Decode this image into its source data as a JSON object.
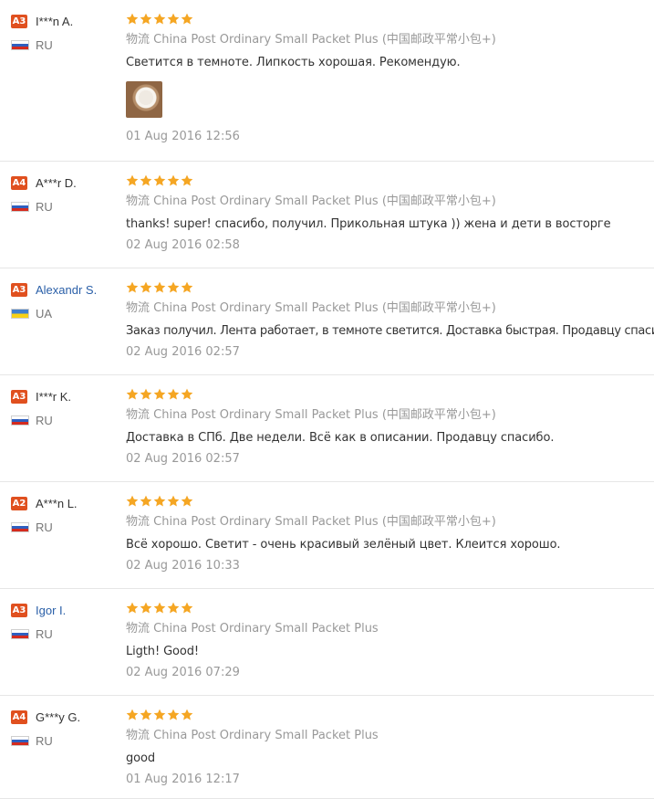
{
  "colors": {
    "badge": "#e0501f",
    "star": "#f5a623",
    "link": "#2a5fa8",
    "muted": "#999999"
  },
  "reviews": [
    {
      "level": "A3",
      "name": "I***n A.",
      "name_link": false,
      "flag": "ru-flag-icon",
      "country": "RU",
      "stars": 5,
      "ship_label": "物流",
      "shipping": "China Post Ordinary Small Packet Plus (中国邮政平常小包+)",
      "text": "Светится в темноте. Липкость хорошая. Рекомендую.",
      "has_photo": true,
      "date": "01 Aug 2016 12:56"
    },
    {
      "level": "A4",
      "name": "A***r D.",
      "name_link": false,
      "flag": "ru-flag-icon",
      "country": "RU",
      "stars": 5,
      "ship_label": "物流",
      "shipping": "China Post Ordinary Small Packet Plus (中国邮政平常小包+)",
      "text": "thanks! super! спасибо, получил. Прикольная штука )) жена и дети в восторге",
      "has_photo": false,
      "date": "02 Aug 2016 02:58"
    },
    {
      "level": "A3",
      "name": "Alexandr S.",
      "name_link": true,
      "flag": "ua-flag-icon",
      "country": "UA",
      "stars": 5,
      "ship_label": "物流",
      "shipping": "China Post Ordinary Small Packet Plus (中国邮政平常小包+)",
      "text": "Заказ получил. Лента работает, в темноте светится. Доставка быстрая. Продавцу спасибо!",
      "has_photo": false,
      "date": "02 Aug 2016 02:57"
    },
    {
      "level": "A3",
      "name": "I***r K.",
      "name_link": false,
      "flag": "ru-flag-icon",
      "country": "RU",
      "stars": 5,
      "ship_label": "物流",
      "shipping": "China Post Ordinary Small Packet Plus (中国邮政平常小包+)",
      "text": "Доставка в СПб. Две недели. Всё как в описании. Продавцу спасибо.",
      "has_photo": false,
      "date": "02 Aug 2016 02:57"
    },
    {
      "level": "A2",
      "name": "A***n L.",
      "name_link": false,
      "flag": "ru-flag-icon",
      "country": "RU",
      "stars": 5,
      "ship_label": "物流",
      "shipping": "China Post Ordinary Small Packet Plus (中国邮政平常小包+)",
      "text": "Всё хорошо. Светит - очень красивый зелёный цвет. Клеится хорошо.",
      "has_photo": false,
      "date": "02 Aug 2016 10:33"
    },
    {
      "level": "A3",
      "name": "Igor I.",
      "name_link": true,
      "flag": "ru-flag-icon",
      "country": "RU",
      "stars": 5,
      "ship_label": "物流",
      "shipping": "China Post Ordinary Small Packet Plus",
      "text": "Ligth! Good!",
      "has_photo": false,
      "date": "02 Aug 2016 07:29"
    },
    {
      "level": "A4",
      "name": "G***y G.",
      "name_link": false,
      "flag": "ru-flag-icon",
      "country": "RU",
      "stars": 5,
      "ship_label": "物流",
      "shipping": "China Post Ordinary Small Packet Plus",
      "text": "good",
      "has_photo": false,
      "date": "01 Aug 2016 12:17"
    }
  ]
}
